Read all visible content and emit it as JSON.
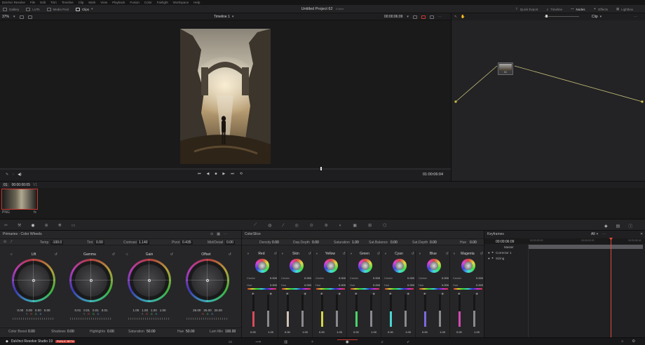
{
  "app": {
    "menu": [
      "DaVinci Resolve",
      "File",
      "Edit",
      "Trim",
      "Timeline",
      "Clip",
      "Mark",
      "View",
      "Playback",
      "Fusion",
      "Color",
      "Fairlight",
      "Workspace",
      "Help"
    ],
    "project_title": "Untitled Project 62",
    "project_status": "Edited"
  },
  "toolbar": {
    "left": [
      "Gallery",
      "LUTs",
      "Media Pool",
      "Clips"
    ],
    "right": [
      "Quick Export",
      "Timeline",
      "Nodes",
      "Effects",
      "Lightbox"
    ]
  },
  "viewer": {
    "zoom": "37%",
    "timeline_name": "Timeline 1",
    "timecode_top": "00:00:06:09",
    "timecode_main": "01:00:06:04"
  },
  "nodes": {
    "mode": "Clip",
    "node_label": "01"
  },
  "clips": {
    "track": "01",
    "timecode": "00:00:00:05",
    "version": "V1",
    "clip_format": "PNG"
  },
  "primaries": {
    "title": "Primaries - Color Wheels",
    "temp_label": "Temp",
    "temp_value": "-100.0",
    "tint_label": "Tint",
    "tint_value": "0.00",
    "contrast_label": "Contrast",
    "contrast_value": "1.140",
    "pivot_label": "Pivot",
    "pivot_value": "0.435",
    "middetail_label": "Mid/Detail",
    "middetail_value": "0.00",
    "wheels": [
      {
        "name": "Lift",
        "vals": [
          "0.00",
          "0.00",
          "0.00",
          "0.00"
        ]
      },
      {
        "name": "Gamma",
        "vals": [
          "0.01",
          "0.01",
          "0.01",
          "0.01"
        ]
      },
      {
        "name": "Gain",
        "vals": [
          "1.00",
          "1.00",
          "1.00",
          "1.00"
        ]
      },
      {
        "name": "Offset",
        "vals": [
          "25.00",
          "25.00",
          "25.00"
        ]
      }
    ],
    "channel_labels": [
      "Y",
      "R",
      "G",
      "B"
    ],
    "bottom": [
      {
        "label": "Color Boost",
        "value": "0.00"
      },
      {
        "label": "Shadows",
        "value": "0.00"
      },
      {
        "label": "Highlights",
        "value": "0.00"
      },
      {
        "label": "Saturation",
        "value": "50.00"
      },
      {
        "label": "Hue",
        "value": "50.00"
      },
      {
        "label": "Lum Mix",
        "value": "100.00"
      }
    ]
  },
  "colorslice": {
    "title": "ColorSlice",
    "density_label": "Density",
    "density_value": "0.00",
    "depth_label": "Dep.Depth",
    "depth_value": "0.00",
    "saturation_label": "Saturation",
    "saturation_value": "1.00",
    "satbalance_label": "Sat.Balance",
    "satbalance_value": "0.00",
    "satdepth_label": "Sat.Depth",
    "satdepth_value": "0.00",
    "hue_label": "Hue",
    "hue_value": "0.00",
    "center_label": "Center",
    "channels": [
      {
        "name": "Red",
        "center": "0.000",
        "hue": "0.000",
        "color": "#d84a5a",
        "bottom": "1.00"
      },
      {
        "name": "Skin",
        "center": "0.000",
        "hue": "0.000",
        "color": "#cfc2b4",
        "bottom": "1.00"
      },
      {
        "name": "Yellow",
        "center": "0.000",
        "hue": "0.000",
        "color": "#d4d44a",
        "bottom": "1.00"
      },
      {
        "name": "Green",
        "center": "0.000",
        "hue": "0.000",
        "color": "#4ad46a",
        "bottom": "1.00"
      },
      {
        "name": "Cyan",
        "center": "0.000",
        "hue": "0.000",
        "color": "#4ad4d4",
        "bottom": "1.00"
      },
      {
        "name": "Blue",
        "center": "0.000",
        "hue": "0.000",
        "color": "#7a6ae0",
        "bottom": "1.00"
      },
      {
        "name": "Magenta",
        "center": "0.000",
        "hue": "0.000",
        "color": "#d44ab4",
        "bottom": "1.00"
      }
    ],
    "slider_value": "0.00"
  },
  "keyframes": {
    "title": "Keyframes",
    "filter": "All",
    "timecode": "00:00:06:09",
    "ruler": [
      "00:00:00:00",
      "00:00:02:20",
      "00:00:05:16"
    ],
    "rows": [
      "Master",
      "Corrector 1",
      "Sizing"
    ]
  },
  "status": {
    "app_name": "DaVinci Resolve Studio 19",
    "badge": "PUBLIC BETA"
  },
  "colors": {
    "accent": "#d24a3a",
    "playhead": "#e24a3a",
    "beta_badge": "#c8372e"
  }
}
